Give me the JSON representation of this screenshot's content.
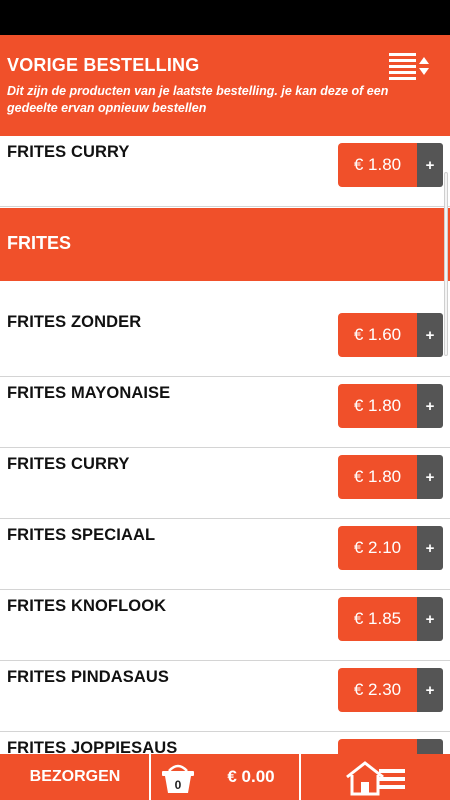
{
  "header": {
    "title": "VORIGE BESTELLING",
    "subtitle": "Dit zijn de producten van je laatste bestelling. je kan deze of een gedeelte ervan opnieuw bestellen"
  },
  "previous_order": [
    {
      "name": "FRITES CURRY",
      "price": "€ 1.80",
      "add": "+"
    }
  ],
  "section": {
    "title": "FRITES"
  },
  "products": [
    {
      "name": "FRITES ZONDER",
      "price": "€ 1.60",
      "add": "+"
    },
    {
      "name": "FRITES MAYONAISE",
      "price": "€ 1.80",
      "add": "+"
    },
    {
      "name": "FRITES CURRY",
      "price": "€ 1.80",
      "add": "+"
    },
    {
      "name": "FRITES SPECIAAL",
      "price": "€ 2.10",
      "add": "+"
    },
    {
      "name": "FRITES KNOFLOOK",
      "price": "€ 1.85",
      "add": "+"
    },
    {
      "name": "FRITES PINDASAUS",
      "price": "€ 2.30",
      "add": "+"
    },
    {
      "name": "FRITES JOPPIESAUS",
      "price": "",
      "add": ""
    }
  ],
  "bottom_bar": {
    "deliver_label": "BEZORGEN",
    "basket_count": "0",
    "total": "€ 0.00"
  },
  "icons": {
    "sort": "sort-list-icon",
    "basket": "basket-icon",
    "home": "home-menu-icon"
  },
  "colors": {
    "accent": "#f0502a",
    "add_button": "#555555",
    "status_bar": "#000000"
  }
}
